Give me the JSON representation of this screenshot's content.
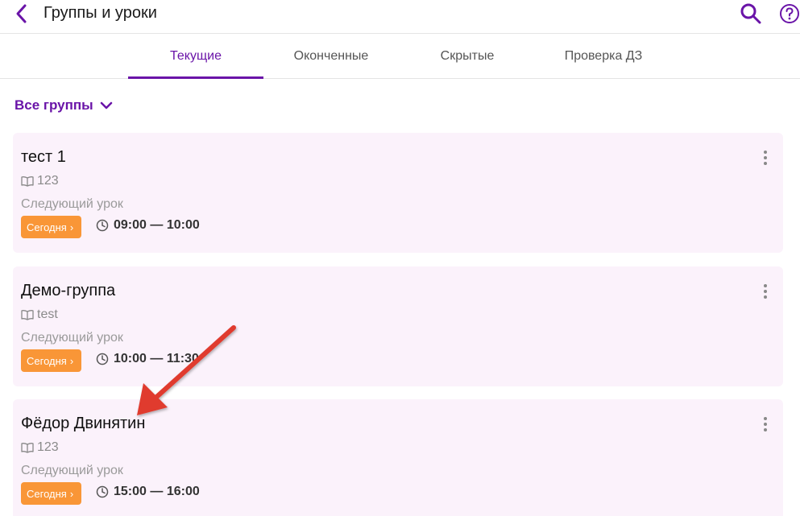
{
  "header": {
    "title": "Группы и уроки",
    "icons": {
      "back": "chevron-left-icon",
      "search": "search-icon",
      "help": "help-icon"
    }
  },
  "tabs": [
    {
      "label": "Текущие",
      "active": true
    },
    {
      "label": "Оконченные",
      "active": false
    },
    {
      "label": "Скрытые",
      "active": false
    },
    {
      "label": "Проверка ДЗ",
      "active": false
    }
  ],
  "filter": {
    "label": "Все группы",
    "icon": "chevron-down-icon"
  },
  "cards": [
    {
      "title": "тест 1",
      "subject": "123",
      "next_label": "Следующий урок",
      "day_badge": "Сегодня",
      "time": "09:00 — 10:00"
    },
    {
      "title": "Демо-группа",
      "subject": "test",
      "next_label": "Следующий урок",
      "day_badge": "Сегодня",
      "time": "10:00 — 11:30"
    },
    {
      "title": "Фёдор Двинятин",
      "subject": "123",
      "next_label": "Следующий урок",
      "day_badge": "Сегодня",
      "time": "15:00 — 16:00"
    }
  ],
  "colors": {
    "accent": "#6a14a8",
    "badge": "#f99637",
    "card_bg": "#fbf2fb",
    "annotation_arrow": "#e03a2f"
  }
}
